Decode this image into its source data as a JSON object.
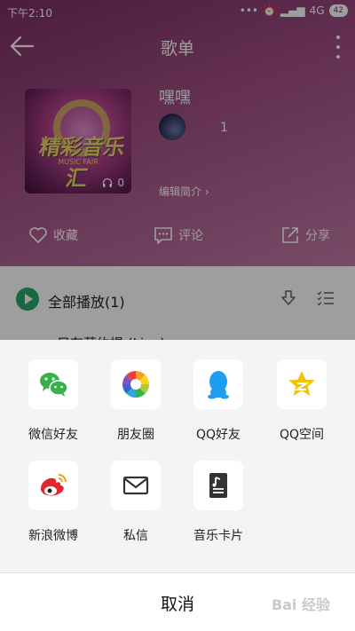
{
  "status_bar": {
    "time": "下午2:10",
    "network": "4G",
    "battery": "42"
  },
  "nav": {
    "title": "歌单"
  },
  "playlist": {
    "name": "嘿嘿",
    "cover_title": "精彩音乐汇",
    "cover_subtitle": "MUSIC FAIR",
    "play_count": "0",
    "creator_count": "1",
    "edit_intro": "编辑简介 ›"
  },
  "actions": {
    "favorite": "收藏",
    "comment": "评论",
    "share": "分享"
  },
  "list": {
    "play_all": "全部播放(1)",
    "song_peek": "只有莫约提 (Live)"
  },
  "share_sheet": {
    "items": [
      {
        "label": "微信好友",
        "icon": "wechat-icon"
      },
      {
        "label": "朋友圈",
        "icon": "moments-icon"
      },
      {
        "label": "QQ好友",
        "icon": "qq-icon"
      },
      {
        "label": "QQ空间",
        "icon": "qzone-icon"
      },
      {
        "label": "新浪微博",
        "icon": "weibo-icon"
      },
      {
        "label": "私信",
        "icon": "mail-icon"
      },
      {
        "label": "音乐卡片",
        "icon": "music-card-icon"
      }
    ],
    "cancel": "取消"
  },
  "watermark": "Bai 经验",
  "colors": {
    "header": "#7b2f63",
    "accent_green": "#2aa867",
    "wechat": "#36b24a",
    "qq": "#1f9ef0",
    "qzone": "#f5c400",
    "weibo": "#e0282e"
  }
}
